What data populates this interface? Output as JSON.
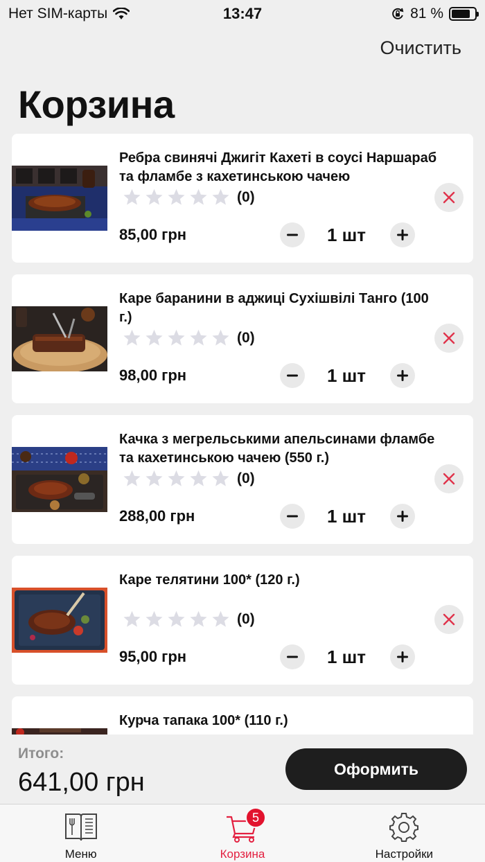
{
  "status_bar": {
    "carrier": "Нет SIM-карты",
    "time": "13:47",
    "battery": "81 %",
    "battery_level": 0.81
  },
  "header": {
    "clear_label": "Очистить",
    "title": "Корзина"
  },
  "cart": {
    "items": [
      {
        "name": "Ребра свинячі Джигіт Кахеті в соусі Наршараб та фламбе з кахетинською чачею",
        "rating_count": "(0)",
        "rating": 0,
        "price": "85,00 грн",
        "qty": "1 шт"
      },
      {
        "name": "Каре баранини в аджиці Сухішвілі Танго (100 г.)",
        "rating_count": "(0)",
        "rating": 0,
        "price": "98,00 грн",
        "qty": "1 шт"
      },
      {
        "name": "Качка з мегрельськими апельсинами фламбе та кахетинською чачею (550 г.)",
        "rating_count": "(0)",
        "rating": 0,
        "price": "288,00 грн",
        "qty": "1 шт"
      },
      {
        "name": "Каре телятини 100* (120 г.)",
        "rating_count": "(0)",
        "rating": 0,
        "price": "95,00 грн",
        "qty": "1 шт"
      },
      {
        "name": "Курча тапака 100* (110 г.)",
        "rating_count": "(0)",
        "rating": 0,
        "price": "",
        "qty": ""
      }
    ]
  },
  "summary": {
    "total_label": "Итого:",
    "total_value": "641,00 грн",
    "checkout_label": "Оформить"
  },
  "tab_bar": {
    "tabs": [
      {
        "label": "Меню",
        "icon": "menu-book-icon"
      },
      {
        "label": "Корзина",
        "icon": "cart-icon",
        "badge": "5"
      },
      {
        "label": "Настройки",
        "icon": "gear-icon"
      }
    ]
  },
  "colors": {
    "accent": "#e32040",
    "badge": "#e2132e",
    "remove_icon": "#e0334b",
    "button_dark": "#1e1e1e",
    "star_empty": "#dcdce4"
  }
}
